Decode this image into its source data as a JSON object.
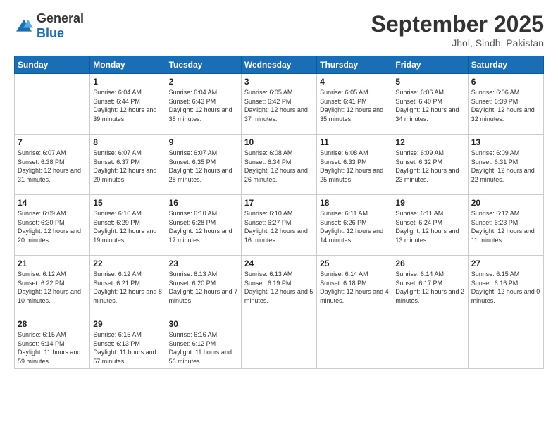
{
  "header": {
    "logo_general": "General",
    "logo_blue": "Blue",
    "month": "September 2025",
    "location": "Jhol, Sindh, Pakistan"
  },
  "weekdays": [
    "Sunday",
    "Monday",
    "Tuesday",
    "Wednesday",
    "Thursday",
    "Friday",
    "Saturday"
  ],
  "weeks": [
    [
      {
        "day": "",
        "sunrise": "",
        "sunset": "",
        "daylight": ""
      },
      {
        "day": "1",
        "sunrise": "Sunrise: 6:04 AM",
        "sunset": "Sunset: 6:44 PM",
        "daylight": "Daylight: 12 hours and 39 minutes."
      },
      {
        "day": "2",
        "sunrise": "Sunrise: 6:04 AM",
        "sunset": "Sunset: 6:43 PM",
        "daylight": "Daylight: 12 hours and 38 minutes."
      },
      {
        "day": "3",
        "sunrise": "Sunrise: 6:05 AM",
        "sunset": "Sunset: 6:42 PM",
        "daylight": "Daylight: 12 hours and 37 minutes."
      },
      {
        "day": "4",
        "sunrise": "Sunrise: 6:05 AM",
        "sunset": "Sunset: 6:41 PM",
        "daylight": "Daylight: 12 hours and 35 minutes."
      },
      {
        "day": "5",
        "sunrise": "Sunrise: 6:06 AM",
        "sunset": "Sunset: 6:40 PM",
        "daylight": "Daylight: 12 hours and 34 minutes."
      },
      {
        "day": "6",
        "sunrise": "Sunrise: 6:06 AM",
        "sunset": "Sunset: 6:39 PM",
        "daylight": "Daylight: 12 hours and 32 minutes."
      }
    ],
    [
      {
        "day": "7",
        "sunrise": "Sunrise: 6:07 AM",
        "sunset": "Sunset: 6:38 PM",
        "daylight": "Daylight: 12 hours and 31 minutes."
      },
      {
        "day": "8",
        "sunrise": "Sunrise: 6:07 AM",
        "sunset": "Sunset: 6:37 PM",
        "daylight": "Daylight: 12 hours and 29 minutes."
      },
      {
        "day": "9",
        "sunrise": "Sunrise: 6:07 AM",
        "sunset": "Sunset: 6:35 PM",
        "daylight": "Daylight: 12 hours and 28 minutes."
      },
      {
        "day": "10",
        "sunrise": "Sunrise: 6:08 AM",
        "sunset": "Sunset: 6:34 PM",
        "daylight": "Daylight: 12 hours and 26 minutes."
      },
      {
        "day": "11",
        "sunrise": "Sunrise: 6:08 AM",
        "sunset": "Sunset: 6:33 PM",
        "daylight": "Daylight: 12 hours and 25 minutes."
      },
      {
        "day": "12",
        "sunrise": "Sunrise: 6:09 AM",
        "sunset": "Sunset: 6:32 PM",
        "daylight": "Daylight: 12 hours and 23 minutes."
      },
      {
        "day": "13",
        "sunrise": "Sunrise: 6:09 AM",
        "sunset": "Sunset: 6:31 PM",
        "daylight": "Daylight: 12 hours and 22 minutes."
      }
    ],
    [
      {
        "day": "14",
        "sunrise": "Sunrise: 6:09 AM",
        "sunset": "Sunset: 6:30 PM",
        "daylight": "Daylight: 12 hours and 20 minutes."
      },
      {
        "day": "15",
        "sunrise": "Sunrise: 6:10 AM",
        "sunset": "Sunset: 6:29 PM",
        "daylight": "Daylight: 12 hours and 19 minutes."
      },
      {
        "day": "16",
        "sunrise": "Sunrise: 6:10 AM",
        "sunset": "Sunset: 6:28 PM",
        "daylight": "Daylight: 12 hours and 17 minutes."
      },
      {
        "day": "17",
        "sunrise": "Sunrise: 6:10 AM",
        "sunset": "Sunset: 6:27 PM",
        "daylight": "Daylight: 12 hours and 16 minutes."
      },
      {
        "day": "18",
        "sunrise": "Sunrise: 6:11 AM",
        "sunset": "Sunset: 6:26 PM",
        "daylight": "Daylight: 12 hours and 14 minutes."
      },
      {
        "day": "19",
        "sunrise": "Sunrise: 6:11 AM",
        "sunset": "Sunset: 6:24 PM",
        "daylight": "Daylight: 12 hours and 13 minutes."
      },
      {
        "day": "20",
        "sunrise": "Sunrise: 6:12 AM",
        "sunset": "Sunset: 6:23 PM",
        "daylight": "Daylight: 12 hours and 11 minutes."
      }
    ],
    [
      {
        "day": "21",
        "sunrise": "Sunrise: 6:12 AM",
        "sunset": "Sunset: 6:22 PM",
        "daylight": "Daylight: 12 hours and 10 minutes."
      },
      {
        "day": "22",
        "sunrise": "Sunrise: 6:12 AM",
        "sunset": "Sunset: 6:21 PM",
        "daylight": "Daylight: 12 hours and 8 minutes."
      },
      {
        "day": "23",
        "sunrise": "Sunrise: 6:13 AM",
        "sunset": "Sunset: 6:20 PM",
        "daylight": "Daylight: 12 hours and 7 minutes."
      },
      {
        "day": "24",
        "sunrise": "Sunrise: 6:13 AM",
        "sunset": "Sunset: 6:19 PM",
        "daylight": "Daylight: 12 hours and 5 minutes."
      },
      {
        "day": "25",
        "sunrise": "Sunrise: 6:14 AM",
        "sunset": "Sunset: 6:18 PM",
        "daylight": "Daylight: 12 hours and 4 minutes."
      },
      {
        "day": "26",
        "sunrise": "Sunrise: 6:14 AM",
        "sunset": "Sunset: 6:17 PM",
        "daylight": "Daylight: 12 hours and 2 minutes."
      },
      {
        "day": "27",
        "sunrise": "Sunrise: 6:15 AM",
        "sunset": "Sunset: 6:16 PM",
        "daylight": "Daylight: 12 hours and 0 minutes."
      }
    ],
    [
      {
        "day": "28",
        "sunrise": "Sunrise: 6:15 AM",
        "sunset": "Sunset: 6:14 PM",
        "daylight": "Daylight: 11 hours and 59 minutes."
      },
      {
        "day": "29",
        "sunrise": "Sunrise: 6:15 AM",
        "sunset": "Sunset: 6:13 PM",
        "daylight": "Daylight: 11 hours and 57 minutes."
      },
      {
        "day": "30",
        "sunrise": "Sunrise: 6:16 AM",
        "sunset": "Sunset: 6:12 PM",
        "daylight": "Daylight: 11 hours and 56 minutes."
      },
      {
        "day": "",
        "sunrise": "",
        "sunset": "",
        "daylight": ""
      },
      {
        "day": "",
        "sunrise": "",
        "sunset": "",
        "daylight": ""
      },
      {
        "day": "",
        "sunrise": "",
        "sunset": "",
        "daylight": ""
      },
      {
        "day": "",
        "sunrise": "",
        "sunset": "",
        "daylight": ""
      }
    ]
  ]
}
